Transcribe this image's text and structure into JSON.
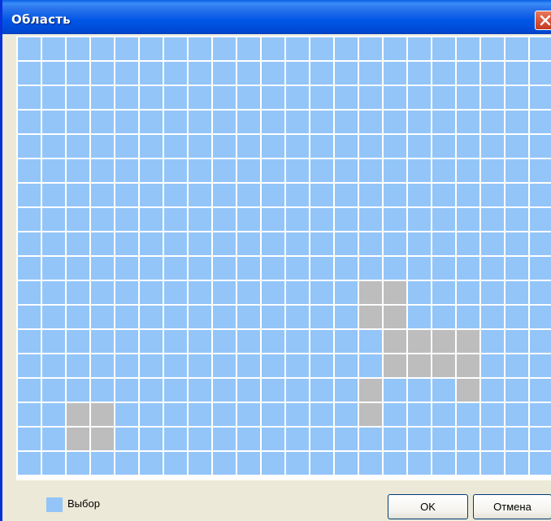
{
  "window": {
    "title": "Область"
  },
  "grid": {
    "rows": 18,
    "cols": 22,
    "colors": {
      "selected": "#93c5f9",
      "unselected": "#bdbdbd"
    },
    "unselected_cells": [
      [
        10,
        14
      ],
      [
        10,
        15
      ],
      [
        11,
        14
      ],
      [
        11,
        15
      ],
      [
        12,
        15
      ],
      [
        12,
        16
      ],
      [
        12,
        17
      ],
      [
        12,
        18
      ],
      [
        13,
        15
      ],
      [
        13,
        16
      ],
      [
        13,
        17
      ],
      [
        13,
        18
      ],
      [
        14,
        14
      ],
      [
        14,
        18
      ],
      [
        15,
        2
      ],
      [
        15,
        3
      ],
      [
        15,
        14
      ],
      [
        16,
        2
      ],
      [
        16,
        3
      ]
    ]
  },
  "legend": {
    "label": "Выбор",
    "color": "#93c5f9"
  },
  "buttons": {
    "ok": "OK",
    "cancel": "Отмена"
  },
  "icons": {
    "close": "close-icon"
  }
}
